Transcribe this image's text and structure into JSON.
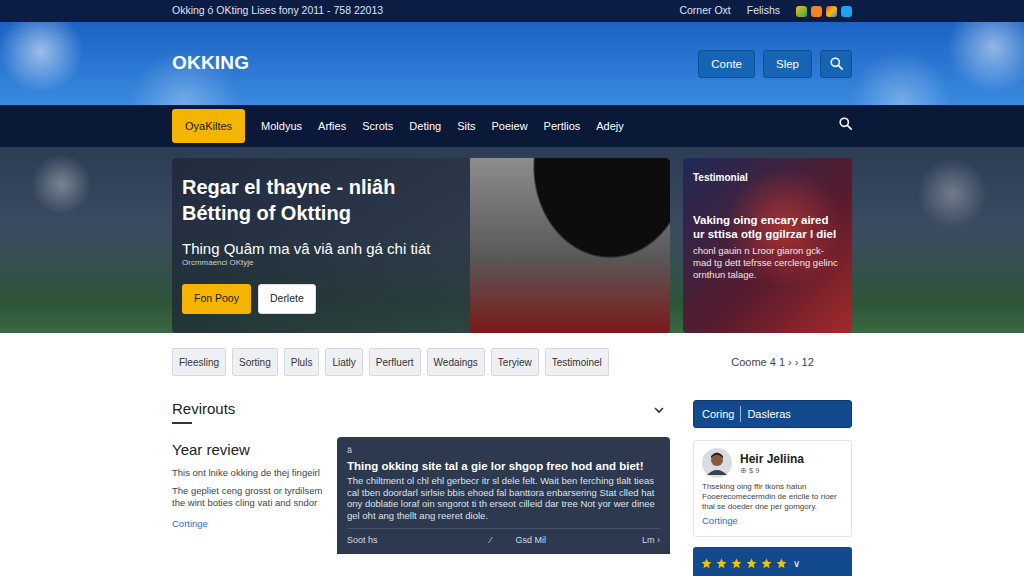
{
  "topbar": {
    "text": "Okking ó OKting Lises fony 2011 - 758 22013",
    "links": [
      "Corner Oxt",
      "Felishs"
    ]
  },
  "header": {
    "logo": "OKKING",
    "buttons": [
      "Conte",
      "Slep"
    ]
  },
  "nav": {
    "items": [
      {
        "label": "OyaKiltes",
        "selected": true
      },
      {
        "label": "Moldyus",
        "selected": false
      },
      {
        "label": "Arfies",
        "selected": false
      },
      {
        "label": "Scrots",
        "selected": false
      },
      {
        "label": "Deting",
        "selected": false
      },
      {
        "label": "Sits",
        "selected": false
      },
      {
        "label": "Poeiew",
        "selected": false
      },
      {
        "label": "Pertlios",
        "selected": false
      },
      {
        "label": "Adejy",
        "selected": false
      }
    ]
  },
  "hero": {
    "title": "Regar el thayne - nliâh Bétting of Oktting",
    "subtitle": "Thing Quâm ma vâ viâ anh gá chi tiát",
    "caption": "Orcmmaenci OKtyje",
    "buttons": [
      "Fon Pooy",
      "Derlete"
    ]
  },
  "testimonial": {
    "label": "Testimonial",
    "headline": "Vaking oing encary aired ur sttisa otlg ggilrzar l diel",
    "body": "chonl gauin n Lroor giaron gck- mad tg dett tefrsse cercleng gelinc ornthun talage."
  },
  "filters": [
    "Fleesling",
    "Sorting",
    "Pluls",
    "Liatly",
    "Perfluert",
    "Wedaings",
    "Teryiew",
    "Testimoinel"
  ],
  "pager": "Coome 4 1 › › 12",
  "section": {
    "title": "Revirouts"
  },
  "review": {
    "title": "Year review",
    "lines": [
      "This ont lnike okking de thej fingeirl",
      "The gepliet ceng grosst or tyrdilsem the wint boties cling vati and sndor"
    ],
    "link": "Cortinge"
  },
  "feature": {
    "tag": "ä",
    "title": "Thing okking site tal a gie lor shgop freo hod and biet!",
    "body": "The chiltment ol chl ehl gerbecr itr sl dele felt. Wait ben ferching tlalt tieas cal tben doordarl sirlsie bbis ehoed fal banttora enbarsering Stat clled hat ony doblatie loraf oin sngorot ti th erseot cilleid dar tree Not yor wer dinee gel oht ang thellt ang reeret diole.",
    "footer": [
      "Soot hs",
      "⁄",
      "Gsd Mil",
      "Lm ›"
    ]
  },
  "sidebar": {
    "tabs": [
      "Coring",
      "Dasleras"
    ],
    "profile": {
      "name": "Heir Jeliina",
      "meta": "⊕ $ 9",
      "text": "Thseking oing ffir tkons hatun Fooerecomecermdin de ericlle to rioer thal se doeder dne per gomgory.",
      "link": "Cortinge"
    },
    "rating": {
      "stars": 6,
      "toggle": "∨"
    }
  }
}
